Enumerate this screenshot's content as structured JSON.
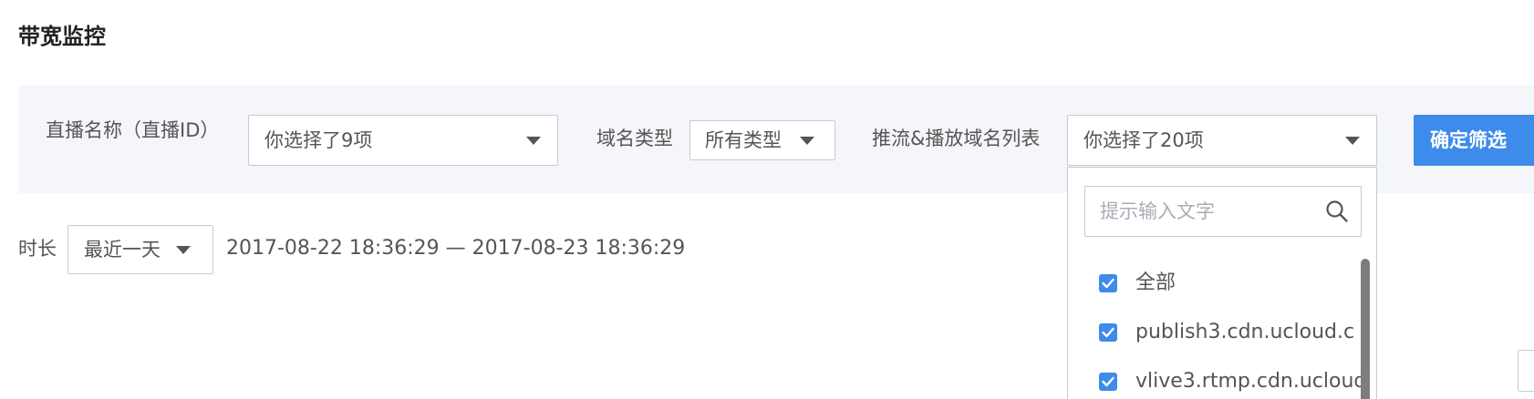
{
  "page": {
    "title": "带宽监控"
  },
  "filters": {
    "live_name_label": "直播名称（直播ID）",
    "live_name_value": "你选择了9项",
    "domain_type_label": "域名类型",
    "domain_type_value": "所有类型",
    "domain_list_label": "推流&播放域名列表",
    "domain_list_value": "你选择了20项",
    "confirm_label": "确定筛选"
  },
  "duration": {
    "label": "时长",
    "value": "最近一天",
    "range_text": "2017-08-22 18:36:29 — 2017-08-23 18:36:29"
  },
  "dropdown": {
    "search_placeholder": "提示输入文字",
    "options": [
      {
        "label": "全部",
        "checked": true
      },
      {
        "label": "publish3.cdn.ucloud.c",
        "checked": true
      },
      {
        "label": "vlive3.rtmp.cdn.ucloud",
        "checked": true
      }
    ]
  },
  "colors": {
    "accent": "#3d8bea",
    "filter_bg": "#f5f6fa",
    "border": "#c5cad3"
  },
  "icons": {
    "search": "search-icon",
    "caret": "caret-down-icon",
    "check": "check-icon"
  }
}
